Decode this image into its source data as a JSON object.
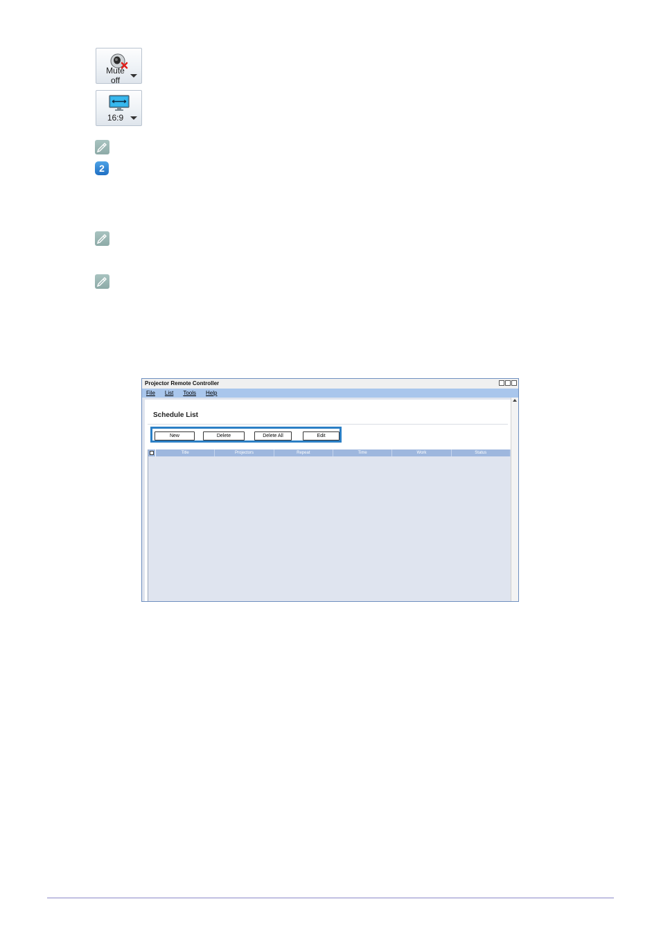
{
  "buttons": {
    "mute": {
      "label": "Mute off",
      "icon": "speaker-mute-icon"
    },
    "aspect": {
      "label": "16:9",
      "icon": "monitor-icon"
    }
  },
  "step_number": "2",
  "window": {
    "title": "Projector Remote Controller",
    "menu": [
      "File",
      "List",
      "Tools",
      "Help"
    ],
    "section_title": "Schedule List",
    "actions": [
      "New",
      "Delete",
      "Delete All",
      "Edit"
    ],
    "columns": [
      "Title",
      "Projectors",
      "Repeat",
      "Time",
      "Work",
      "Status"
    ],
    "highlight_color": "#2b7fc5"
  }
}
